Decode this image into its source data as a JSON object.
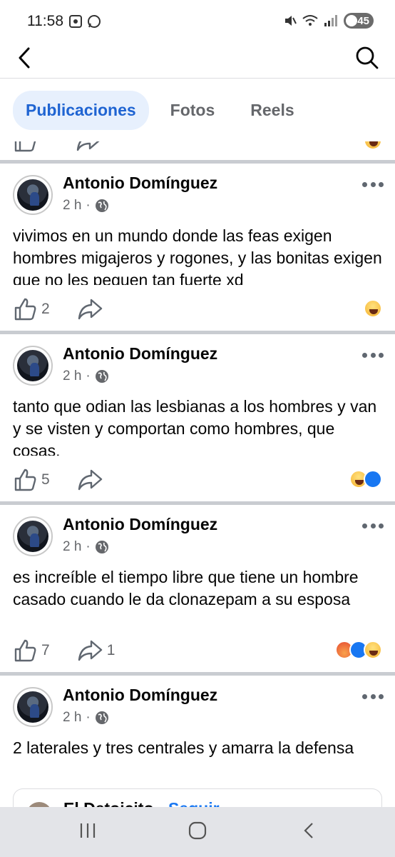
{
  "status": {
    "time": "11:58",
    "battery": "45",
    "icons": [
      "screenshot-icon",
      "whatsapp-icon",
      "mute-icon",
      "wifi-icon",
      "signal-icon",
      "battery-icon"
    ]
  },
  "nav": {
    "back_icon": "back-arrow-icon",
    "search_icon": "search-icon"
  },
  "tabs": [
    {
      "label": "Publicaciones",
      "active": true
    },
    {
      "label": "Fotos",
      "active": false
    },
    {
      "label": "Reels",
      "active": false
    }
  ],
  "posts": [
    {
      "author": "Antonio Domínguez",
      "time": "2 h",
      "text": "vivimos en un mundo donde las feas exigen hombres migajeros y rogones, y las bonitas exigen que no les peguen tan fuerte xd",
      "likes": "2",
      "shares": "",
      "reactions": [
        "haha"
      ]
    },
    {
      "author": "Antonio Domínguez",
      "time": "2 h",
      "text": "tanto que odian las lesbianas a los hombres y van y se visten y comportan como hombres, que cosas.",
      "likes": "5",
      "shares": "",
      "reactions": [
        "haha",
        "like"
      ]
    },
    {
      "author": "Antonio Domínguez",
      "time": "2 h",
      "text": "es increíble el tiempo libre que tiene un hombre casado cuando le da clonazepam a su esposa",
      "likes": "7",
      "shares": "1",
      "reactions": [
        "angry",
        "like",
        "haha"
      ]
    },
    {
      "author": "Antonio Domínguez",
      "time": "2 h",
      "text": "2 laterales y tres centrales y amarra la defensa"
    }
  ],
  "shared": {
    "name": "El Detoicito",
    "separator": " · ",
    "follow": "Seguir"
  },
  "colors": {
    "accent": "#1f64d2",
    "tab_active_bg": "#e7f0fd",
    "secondary_text": "#65676b",
    "separator": "#c9ccd1"
  }
}
